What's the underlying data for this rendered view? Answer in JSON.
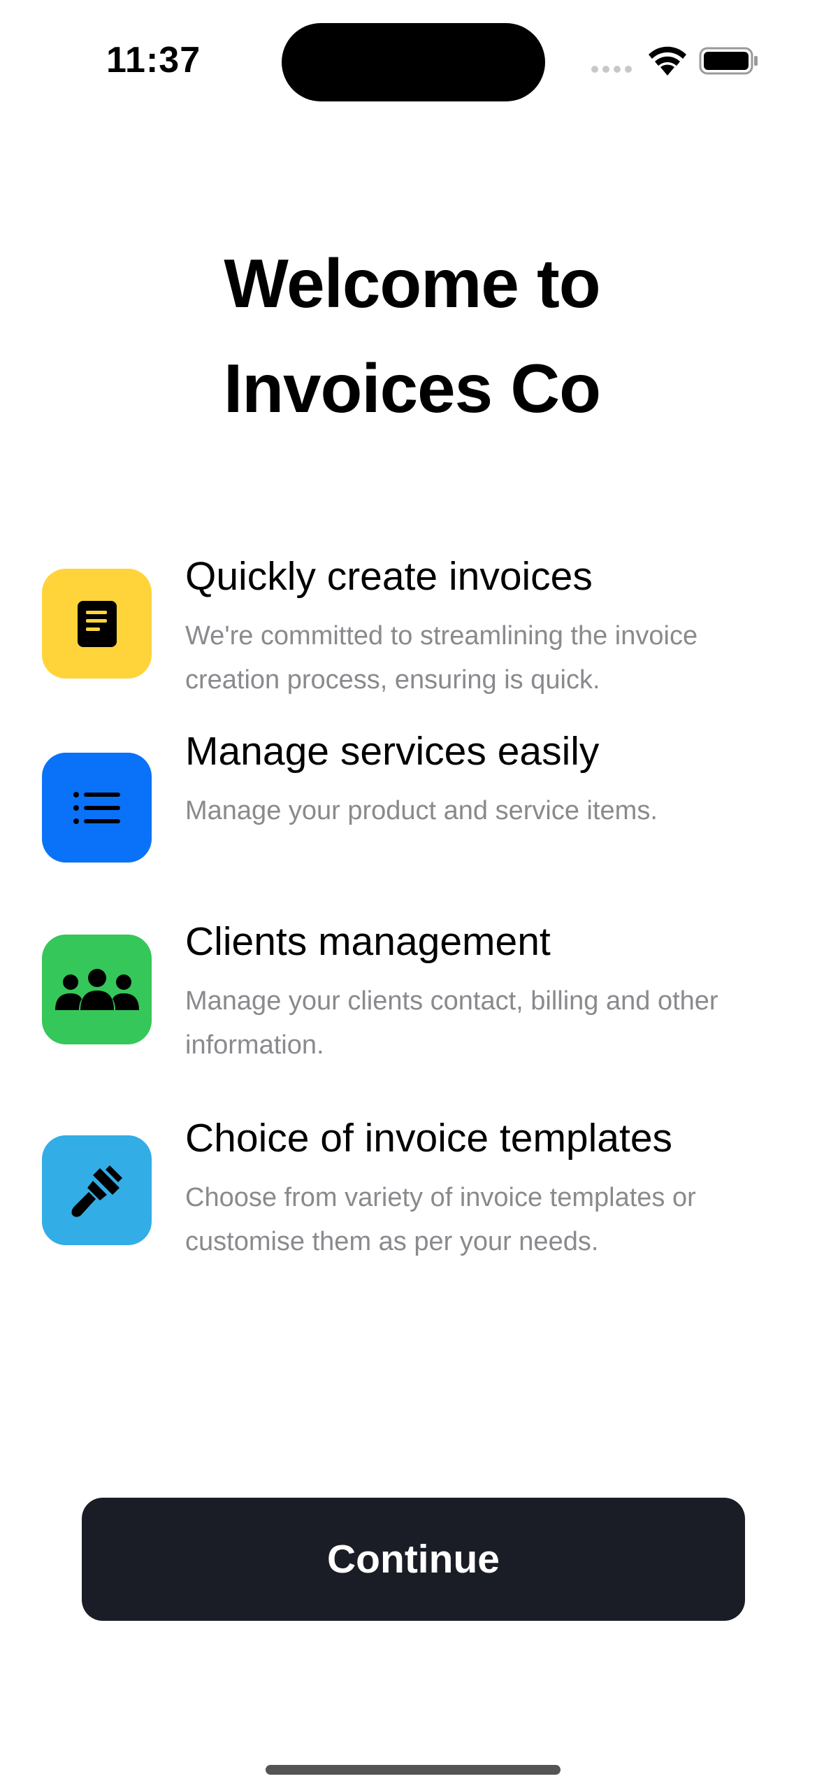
{
  "status_bar": {
    "time": "11:37"
  },
  "welcome": {
    "title_line1": "Welcome to",
    "title_line2": "Invoices Co"
  },
  "features": [
    {
      "title": "Quickly create invoices",
      "description": "We're committed to streamlining the invoice creation process, ensuring is quick.",
      "icon": "document-icon",
      "color": "#FFD43B"
    },
    {
      "title": "Manage services easily",
      "description": "Manage your product and service items.",
      "icon": "list-icon",
      "color": "#0A72F9"
    },
    {
      "title": "Clients management",
      "description": "Manage your clients contact, billing and other information.",
      "icon": "people-icon",
      "color": "#35C759"
    },
    {
      "title": "Choice of invoice templates",
      "description": "Choose from variety of invoice templates or customise them as per your needs.",
      "icon": "paintbrush-icon",
      "color": "#32ADE6"
    }
  ],
  "continue_label": "Continue"
}
